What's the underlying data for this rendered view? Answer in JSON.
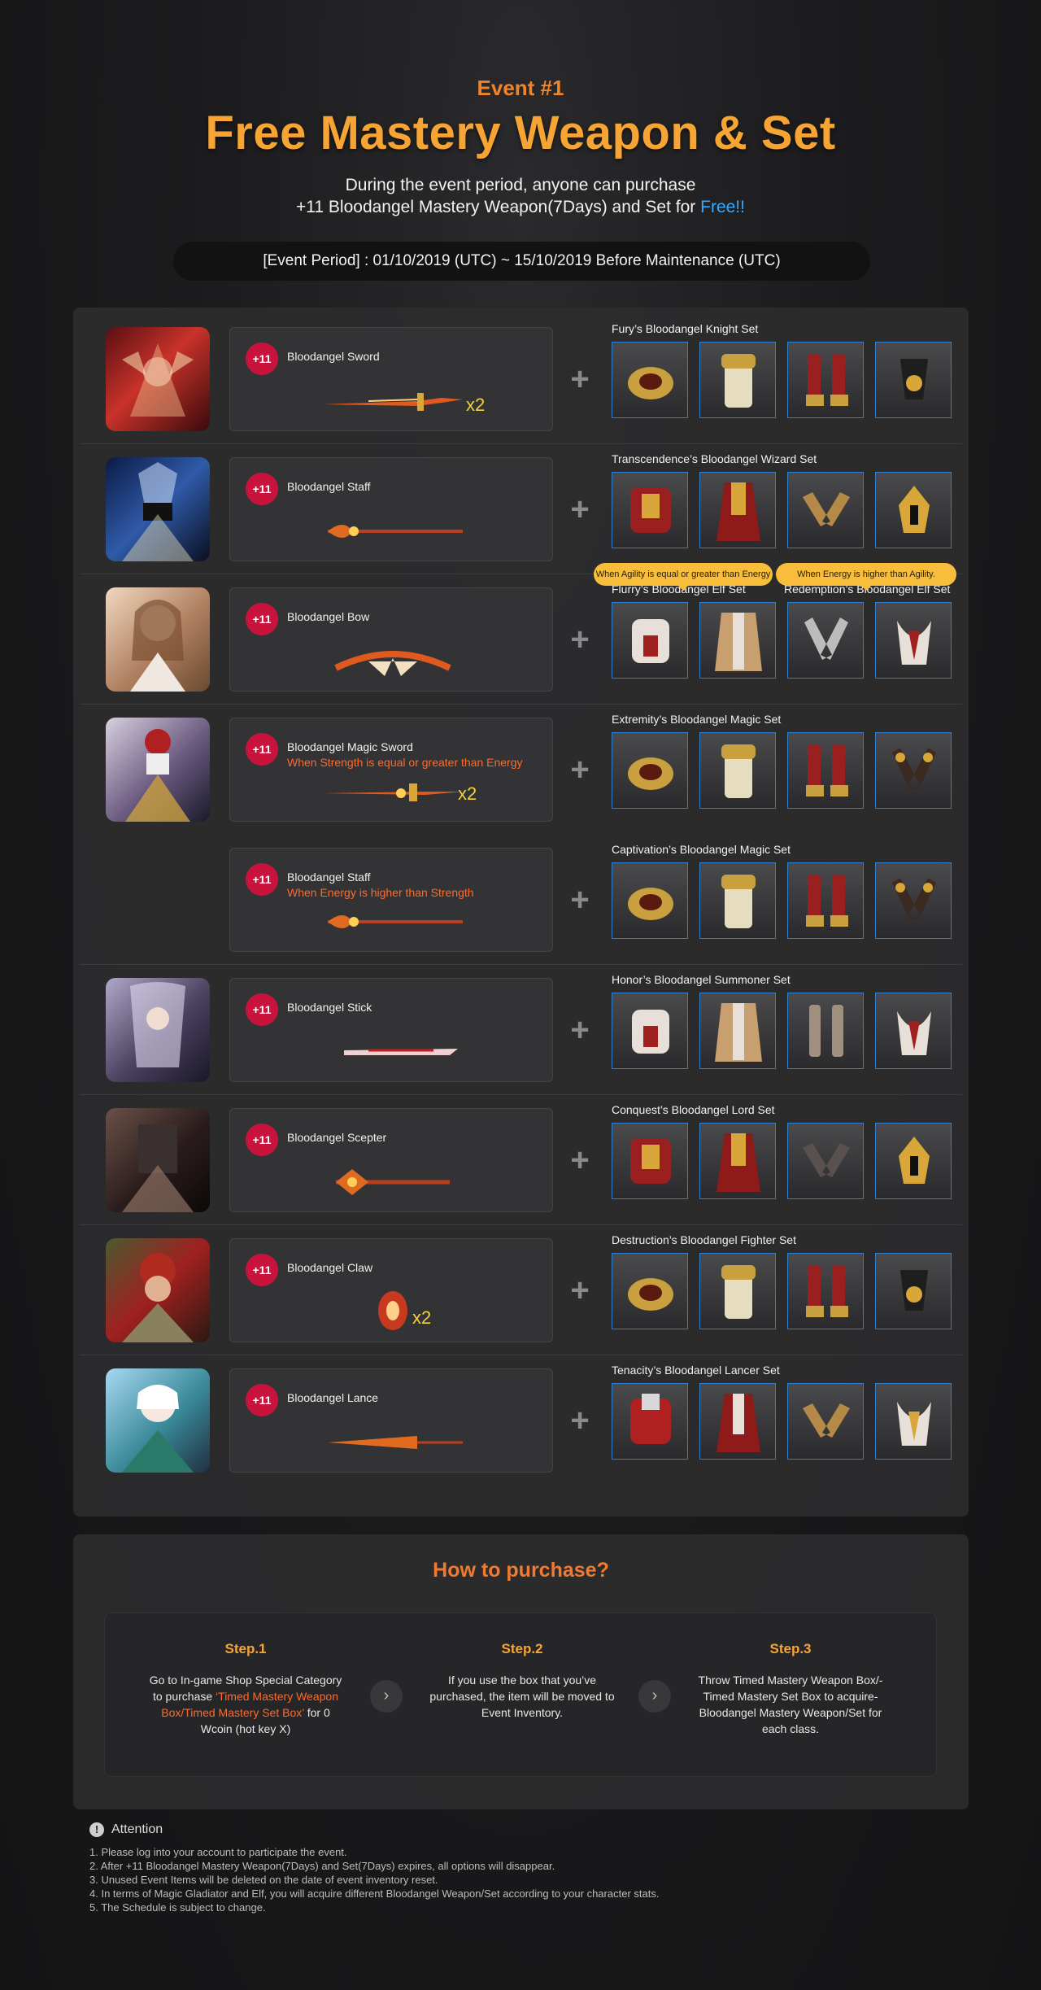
{
  "header": {
    "event_no": "Event #1",
    "title": "Free Mastery Weapon & Set",
    "desc_line1": "During the event period, anyone can purchase",
    "desc_line2": "+11 Bloodangel Mastery Weapon(7Days) and Set for",
    "desc_free": "Free!!",
    "period": "[Event Period] :  01/10/2019 (UTC) ~ 15/10/2019 Before Maintenance (UTC)"
  },
  "badge_label": "+11",
  "plus_sign": "+",
  "rows": [
    {
      "weapon": "Bloodangel Sword",
      "condition": "",
      "multiplier": "x2",
      "set": "Fury’s Bloodangel Knight Set"
    },
    {
      "weapon": "Bloodangel Staff",
      "condition": "",
      "multiplier": "",
      "set": "Transcendence’s Bloodangel Wizard Set"
    },
    {
      "weapon": "Bloodangel Bow",
      "condition": "",
      "multiplier": "",
      "set": "Flurry’s Bloodangel Elf Set",
      "set2": "Redemption’s Bloodangel Elf Set",
      "tip1": "When Agility is equal or greater than Energy",
      "tip2": "When Energy is higher than Agility."
    },
    {
      "weapon": "Bloodangel Magic Sword",
      "condition": "When Strength is equal or greater than Energy",
      "multiplier": "x2",
      "set": "Extremity’s Bloodangel Magic Set"
    },
    {
      "weapon": "Bloodangel Staff",
      "condition": "When Energy is higher than Strength",
      "multiplier": "",
      "set": "Captivation’s Bloodangel Magic Set"
    },
    {
      "weapon": "Bloodangel Stick",
      "condition": "",
      "multiplier": "",
      "set": "Honor’s Bloodangel Summoner Set"
    },
    {
      "weapon": "Bloodangel Scepter",
      "condition": "",
      "multiplier": "",
      "set": "Conquest’s Bloodangel Lord Set"
    },
    {
      "weapon": "Bloodangel Claw",
      "condition": "",
      "multiplier": "x2",
      "set": "Destruction’s Bloodangel Fighter Set"
    },
    {
      "weapon": "Bloodangel Lance",
      "condition": "",
      "multiplier": "",
      "set": "Tenacity’s Bloodangel Lancer Set"
    }
  ],
  "how": {
    "title": "How to purchase?",
    "steps": [
      {
        "title": "Step.1",
        "text_a": "Go to In-game Shop Special Category to purchase ",
        "text_hl": "‘Timed Mastery Weapon Box/Timed Mastery Set Box’",
        "text_b": " for 0 Wcoin (hot key X)"
      },
      {
        "title": "Step.2",
        "text_a": "If you use the box that you’ve purchased, the item will be moved to Event Inventory.",
        "text_hl": "",
        "text_b": ""
      },
      {
        "title": "Step.3",
        "text_a": "Throw Timed Mastery Weapon Box/-Timed Mastery Set Box to acquire-Bloodangel Mastery Weapon/Set for each class.",
        "text_hl": "",
        "text_b": ""
      }
    ]
  },
  "attention": {
    "title": "Attention",
    "icon": "exclamation-icon",
    "lines": [
      "1. Please log into your account to participate the event.",
      "2. After +11 Bloodangel Mastery Weapon(7Days) and Set(7Days) expires, all options will disappear.",
      "3. Unused Event Items will be deleted on the date of event inventory reset.",
      "4. In terms of Magic Gladiator and Elf, you will acquire different Bloodangel Weapon/Set according to your character stats.",
      "5. The Schedule is subject to change."
    ]
  },
  "colors": {
    "accent_orange": "#f6a434",
    "badge_red": "#c8143c",
    "free_blue": "#36a9ff",
    "highlight": "#ff6a2a",
    "item_border": "#2e7fd0"
  }
}
